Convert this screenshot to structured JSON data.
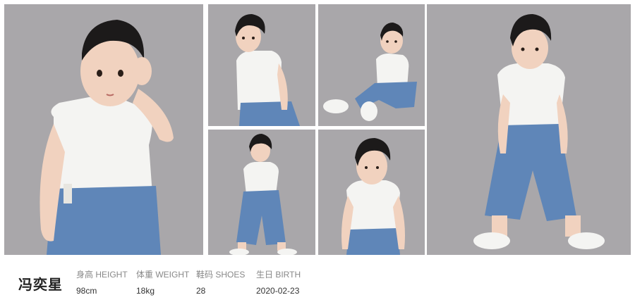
{
  "profile": {
    "name": "冯奕星",
    "fields": [
      {
        "label": "身高 HEIGHT",
        "value": "98cm"
      },
      {
        "label": "体重 WEIGHT",
        "value": "18kg"
      },
      {
        "label": "鞋码 SHOES",
        "value": "28"
      },
      {
        "label": "生日 BIRTH",
        "value": "2020-02-23"
      }
    ]
  },
  "colors": {
    "backdrop": "#a9a7aa",
    "shirt": "#f4f4f2",
    "denim": "#5f86b8",
    "hair": "#1c1a1a",
    "skin": "#f1d2bf"
  }
}
